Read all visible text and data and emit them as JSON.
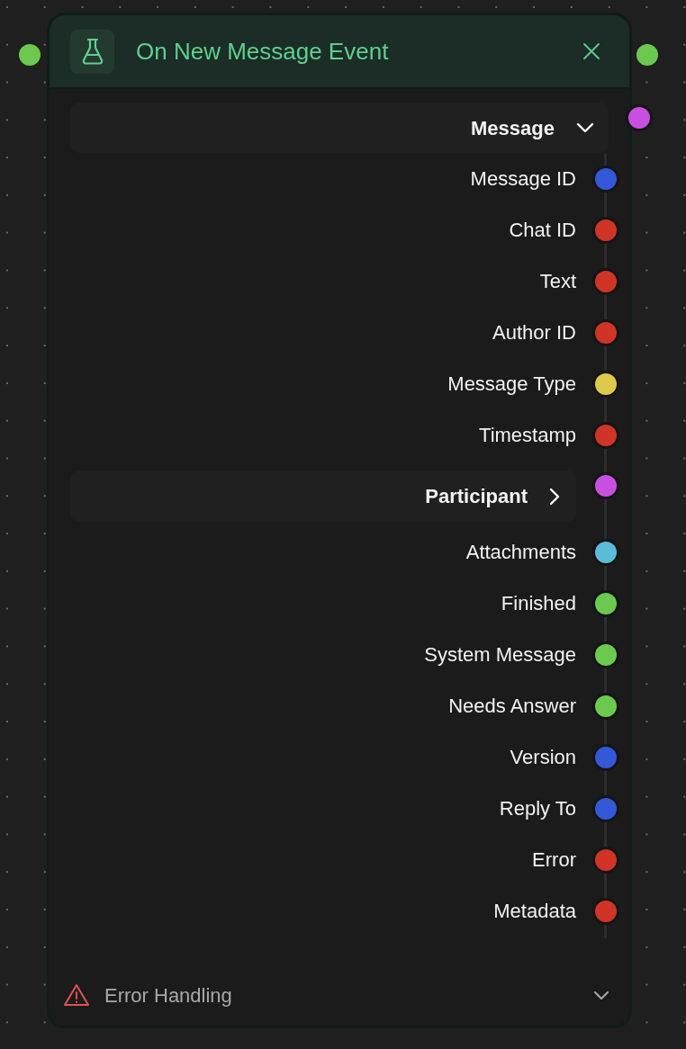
{
  "node": {
    "title": "On New Message Event",
    "outputs": [
      {
        "kind": "group",
        "label": "Message",
        "expanded": true,
        "color": "#c94fe0"
      },
      {
        "kind": "field",
        "label": "Message ID",
        "color": "#3358d8"
      },
      {
        "kind": "field",
        "label": "Chat ID",
        "color": "#d03427"
      },
      {
        "kind": "field",
        "label": "Text",
        "color": "#d03427"
      },
      {
        "kind": "field",
        "label": "Author ID",
        "color": "#d03427"
      },
      {
        "kind": "field",
        "label": "Message Type",
        "color": "#dcc94a"
      },
      {
        "kind": "field",
        "label": "Timestamp",
        "color": "#d03427"
      },
      {
        "kind": "group",
        "label": "Participant",
        "expanded": false,
        "color": "#c94fe0"
      },
      {
        "kind": "field",
        "label": "Attachments",
        "color": "#5bbcd8"
      },
      {
        "kind": "field",
        "label": "Finished",
        "color": "#6cc94f"
      },
      {
        "kind": "field",
        "label": "System Message",
        "color": "#6cc94f"
      },
      {
        "kind": "field",
        "label": "Needs Answer",
        "color": "#6cc94f"
      },
      {
        "kind": "field",
        "label": "Version",
        "color": "#3358d8"
      },
      {
        "kind": "field",
        "label": "Reply To",
        "color": "#3358d8"
      },
      {
        "kind": "field",
        "label": "Error",
        "color": "#d03427"
      },
      {
        "kind": "field",
        "label": "Metadata",
        "color": "#d03427"
      }
    ],
    "footer": {
      "label": "Error Handling"
    }
  }
}
